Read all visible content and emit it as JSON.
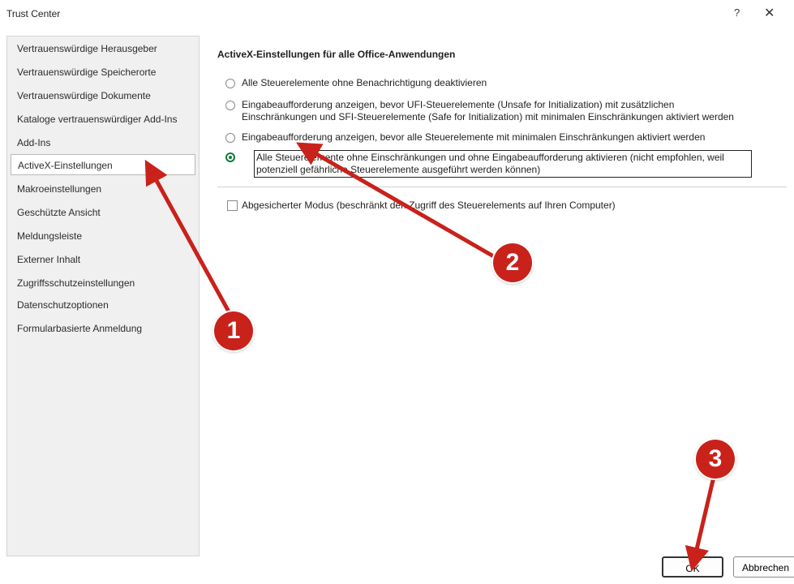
{
  "window": {
    "title": "Trust Center",
    "help_label": "?",
    "close_label": "✕"
  },
  "sidebar": {
    "items": [
      {
        "label": "Vertrauenswürdige Herausgeber"
      },
      {
        "label": "Vertrauenswürdige Speicherorte"
      },
      {
        "label": "Vertrauenswürdige Dokumente"
      },
      {
        "label": "Kataloge vertrauenswürdiger Add-Ins"
      },
      {
        "label": "Add-Ins"
      },
      {
        "label": "ActiveX-Einstellungen",
        "selected": true
      },
      {
        "label": "Makroeinstellungen"
      },
      {
        "label": "Geschützte Ansicht"
      },
      {
        "label": "Meldungsleiste"
      },
      {
        "label": "Externer Inhalt"
      },
      {
        "label": "Zugriffsschutzeinstellungen"
      },
      {
        "label": "Datenschutzoptionen"
      },
      {
        "label": "Formularbasierte Anmeldung"
      }
    ]
  },
  "main": {
    "section_title": "ActiveX-Einstellungen für alle Office-Anwendungen",
    "options": [
      {
        "line1": "Alle Steuerelemente ohne Benachrichtigung deaktivieren",
        "line2": "",
        "selected": false
      },
      {
        "line1": "Eingabeaufforderung anzeigen, bevor UFI-Steuerelemente (Unsafe for Initialization) mit zusätzlichen",
        "line2": "Einschränkungen und SFI-Steuerelemente (Safe for Initialization) mit minimalen Einschränkungen aktiviert werden",
        "selected": false
      },
      {
        "line1": "Eingabeaufforderung anzeigen, bevor alle Steuerelemente mit minimalen Einschränkungen aktiviert werden",
        "line2": "",
        "selected": false
      },
      {
        "line1": "Alle Steuerelemente ohne Einschränkungen und ohne Eingabeaufforderung aktivieren (nicht empfohlen, weil",
        "line2": "potenziell gefährliche Steuerelemente ausgeführt werden können)",
        "selected": true
      }
    ],
    "safe_mode": {
      "label": "Abgesicherter Modus (beschränkt den Zugriff des Steuerelements auf Ihren Computer)",
      "checked": false
    }
  },
  "buttons": {
    "ok": "OK",
    "cancel": "Abbrechen"
  },
  "annotations": {
    "badge1": "1",
    "badge2": "2",
    "badge3": "3",
    "color": "#c8221b"
  }
}
